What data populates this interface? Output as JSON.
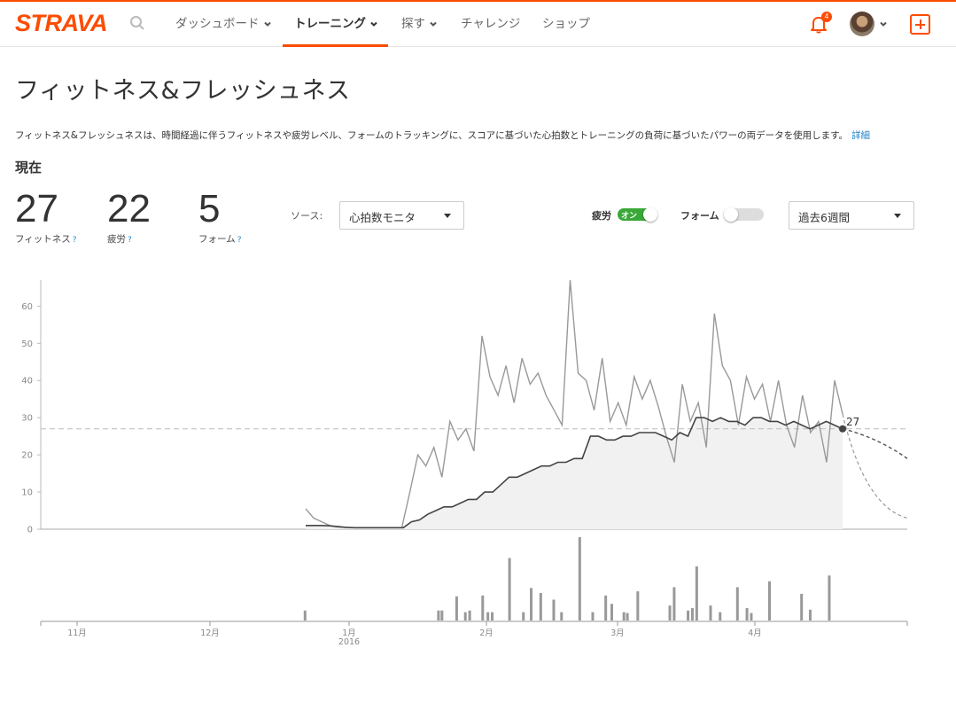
{
  "brand": {
    "name": "STRAVA",
    "color": "#fc4c02"
  },
  "nav": {
    "items": [
      {
        "label": "ダッシュボード",
        "chevron": true
      },
      {
        "label": "トレーニング",
        "chevron": true,
        "active": true
      },
      {
        "label": "探す",
        "chevron": true
      },
      {
        "label": "チャレンジ",
        "chevron": false
      },
      {
        "label": "ショップ",
        "chevron": false
      }
    ],
    "notification_count": "4"
  },
  "page": {
    "title": "フィットネス&フレッシュネス",
    "description": "フィットネス&フレッシュネスは、時間経過に伴うフィットネスや疲労レベル、フォームのトラッキングに、スコアに基づいた心拍数とトレーニングの負荷に基づいたパワーの両データを使用します。",
    "details_link": "詳細",
    "current_heading": "現在"
  },
  "stats": [
    {
      "value": "27",
      "label": "フィットネス",
      "help": "?"
    },
    {
      "value": "22",
      "label": "疲労",
      "help": "?"
    },
    {
      "value": "5",
      "label": "フォーム",
      "help": "?"
    }
  ],
  "controls": {
    "source_label": "ソース:",
    "source_value": "心拍数モニタ",
    "fatigue_label": "疲労",
    "fatigue_on_text": "オン",
    "fatigue_toggle_on": true,
    "form_label": "フォーム",
    "form_toggle_on": false,
    "range_value": "過去6週間"
  },
  "chart_data": {
    "type": "line",
    "y_ticks": [
      "0",
      "10",
      "20",
      "30",
      "40",
      "50",
      "60"
    ],
    "ylim": [
      0,
      67
    ],
    "x_tick_labels": [
      "11月",
      "12月",
      "1月",
      "2月",
      "3月",
      "4月"
    ],
    "x_sub_label": "2016",
    "current_fitness": 27,
    "current_fitness_label": "27",
    "fitness_series": [
      1,
      1,
      1,
      0.9,
      0.7,
      0.5,
      0.4,
      0.4,
      0.4,
      0.4,
      0.4,
      0.4,
      0.4,
      2,
      2.5,
      4,
      5,
      6,
      6,
      7,
      8,
      8,
      10,
      10,
      12,
      14,
      14,
      15,
      16,
      17,
      17,
      18,
      18,
      19,
      19,
      25,
      25,
      24,
      24,
      25,
      25,
      26,
      26,
      26,
      25,
      24,
      26,
      25,
      30,
      30,
      29,
      30,
      29,
      29,
      28,
      30,
      30,
      29,
      29,
      28,
      29,
      28,
      27,
      28,
      29,
      28,
      27
    ],
    "fatigue_series": [
      5.5,
      3,
      2,
      1,
      0.6,
      0.5,
      0.4,
      0.4,
      0.4,
      0.4,
      0.4,
      0.4,
      0.4,
      10,
      20,
      17,
      22,
      14,
      29,
      24,
      27,
      21,
      52,
      41,
      36,
      44,
      34,
      46,
      39,
      42,
      36,
      32,
      28,
      67,
      42,
      40,
      32,
      46,
      29,
      34,
      28,
      41,
      35,
      40,
      33,
      25,
      18,
      39,
      29,
      34,
      22,
      58,
      44,
      40,
      28,
      41,
      35,
      39,
      29,
      40,
      28,
      22,
      36,
      26,
      29,
      18,
      40,
      31
    ],
    "fitness_projection_end": 19,
    "fatigue_projection_end": 3,
    "daily_load_bars": [
      {
        "x": 0.305,
        "v": 0.12
      },
      {
        "x": 0.459,
        "v": 0.12
      },
      {
        "x": 0.463,
        "v": 0.12
      },
      {
        "x": 0.48,
        "v": 0.29
      },
      {
        "x": 0.49,
        "v": 0.1
      },
      {
        "x": 0.495,
        "v": 0.12
      },
      {
        "x": 0.51,
        "v": 0.3
      },
      {
        "x": 0.516,
        "v": 0.1
      },
      {
        "x": 0.521,
        "v": 0.1
      },
      {
        "x": 0.541,
        "v": 0.75
      },
      {
        "x": 0.557,
        "v": 0.1
      },
      {
        "x": 0.566,
        "v": 0.39
      },
      {
        "x": 0.577,
        "v": 0.33
      },
      {
        "x": 0.592,
        "v": 0.25
      },
      {
        "x": 0.601,
        "v": 0.1
      },
      {
        "x": 0.622,
        "v": 1.0
      },
      {
        "x": 0.637,
        "v": 0.1
      },
      {
        "x": 0.652,
        "v": 0.3
      },
      {
        "x": 0.659,
        "v": 0.2
      },
      {
        "x": 0.673,
        "v": 0.1
      },
      {
        "x": 0.677,
        "v": 0.09
      },
      {
        "x": 0.689,
        "v": 0.35
      },
      {
        "x": 0.726,
        "v": 0.18
      },
      {
        "x": 0.731,
        "v": 0.4
      },
      {
        "x": 0.747,
        "v": 0.12
      },
      {
        "x": 0.752,
        "v": 0.15
      },
      {
        "x": 0.757,
        "v": 0.65
      },
      {
        "x": 0.773,
        "v": 0.18
      },
      {
        "x": 0.784,
        "v": 0.1
      },
      {
        "x": 0.804,
        "v": 0.4
      },
      {
        "x": 0.815,
        "v": 0.15
      },
      {
        "x": 0.82,
        "v": 0.09
      },
      {
        "x": 0.841,
        "v": 0.47
      },
      {
        "x": 0.878,
        "v": 0.32
      },
      {
        "x": 0.888,
        "v": 0.13
      },
      {
        "x": 0.91,
        "v": 0.54
      }
    ]
  }
}
